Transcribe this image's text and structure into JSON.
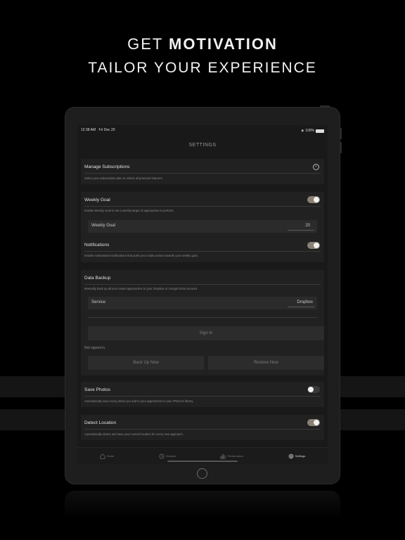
{
  "hero": {
    "line1_prefix": "GET ",
    "line1_bold": "MOTIVATION",
    "line2": "TAILOR YOUR EXPERIENCE"
  },
  "status_bar": {
    "time": "12:38 AM",
    "date": "Fri Dec 20",
    "battery": "100%"
  },
  "settings": {
    "title": "SETTINGS",
    "manage_subscriptions": {
      "title": "Manage Subscriptions",
      "desc": "Select your subscription plan to unlock all premium features."
    },
    "weekly_goal": {
      "title": "Weekly Goal",
      "desc": "Enable Weekly Goal to set a weekly target of approaches to perform.",
      "enabled": true,
      "field_label": "Weekly Goal",
      "field_value": "20"
    },
    "notifications": {
      "title": "Notifications",
      "desc": "Enable motivational notifications that push you to take action towards your weekly goal.",
      "enabled": true
    },
    "data_backup": {
      "title": "Data Backup",
      "desc": "Manually back up all your saved approaches to your Dropbox or Google Drive account.",
      "service_label": "Service",
      "service_value": "Dropbox",
      "sign_in_label": "Sign In",
      "status": "Not signed in.",
      "back_up_now": "Back Up Now",
      "restore_now": "Restore Now"
    },
    "save_photos": {
      "title": "Save Photos",
      "desc": "Automatically save every photo you add to your approaches in your iPhone's library.",
      "enabled": false
    },
    "detect_location": {
      "title": "Detect Location",
      "desc": "Automatically detect and save your current location for every new approach.",
      "enabled": true
    }
  },
  "tabbar": {
    "items": [
      {
        "label": "Home",
        "icon": "home-icon"
      },
      {
        "label": "Session",
        "icon": "session-icon"
      },
      {
        "label": "Performance",
        "icon": "performance-icon"
      },
      {
        "label": "Settings",
        "icon": "settings-icon",
        "active": true
      }
    ]
  },
  "colors": {
    "background": "#000000",
    "toggle_on": "#8a8074",
    "toggle_off": "#3a3a3a"
  }
}
